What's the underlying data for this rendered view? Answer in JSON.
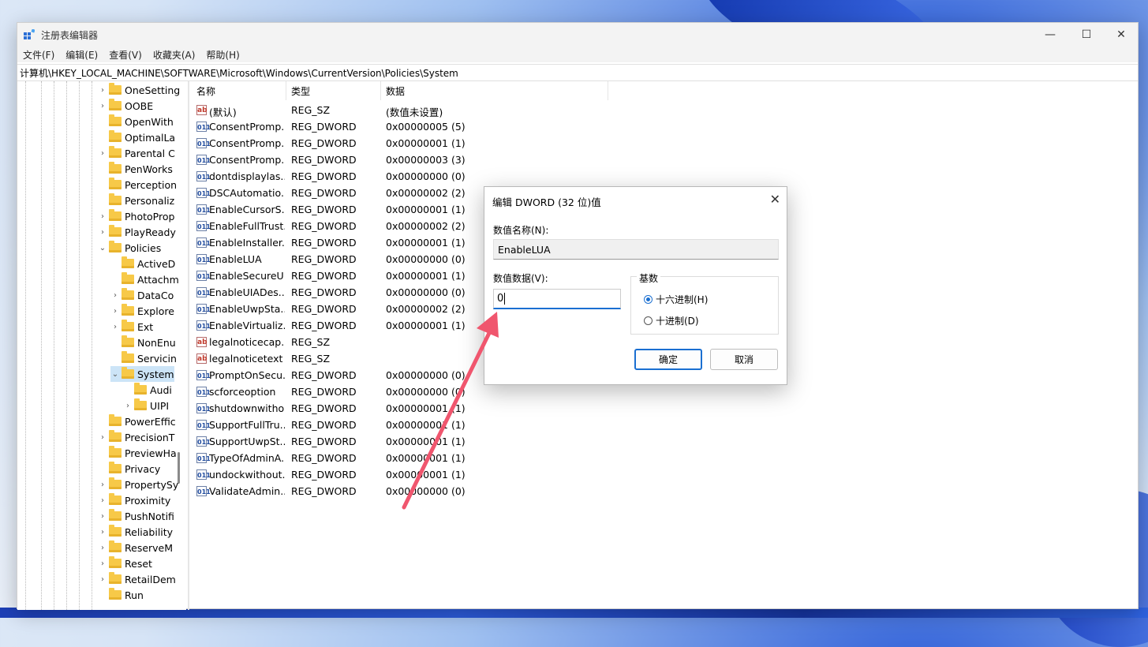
{
  "window": {
    "title": "注册表编辑器",
    "controls": {
      "minimize": "—",
      "maximize": "☐",
      "close": "✕"
    }
  },
  "menu": [
    "文件(F)",
    "编辑(E)",
    "查看(V)",
    "收藏夹(A)",
    "帮助(H)"
  ],
  "address": "计算机\\HKEY_LOCAL_MACHINE\\SOFTWARE\\Microsoft\\Windows\\CurrentVersion\\Policies\\System",
  "tree": [
    {
      "label": "OneSetting",
      "chev": "›"
    },
    {
      "label": "OOBE",
      "chev": "›"
    },
    {
      "label": "OpenWith",
      "chev": ""
    },
    {
      "label": "OptimalLa",
      "chev": ""
    },
    {
      "label": "Parental C",
      "chev": "›"
    },
    {
      "label": "PenWorks",
      "chev": ""
    },
    {
      "label": "Perception",
      "chev": ""
    },
    {
      "label": "Personaliz",
      "chev": ""
    },
    {
      "label": "PhotoProp",
      "chev": "›"
    },
    {
      "label": "PlayReady",
      "chev": "›"
    },
    {
      "label": "Policies",
      "chev": "⌄"
    },
    {
      "label": "ActiveD",
      "chev": ""
    },
    {
      "label": "Attachm",
      "chev": ""
    },
    {
      "label": "DataCo",
      "chev": "›"
    },
    {
      "label": "Explore",
      "chev": "›"
    },
    {
      "label": "Ext",
      "chev": "›"
    },
    {
      "label": "NonEnu",
      "chev": ""
    },
    {
      "label": "Servicin",
      "chev": ""
    },
    {
      "label": "System",
      "chev": "⌄"
    },
    {
      "label": "Audi",
      "chev": ""
    },
    {
      "label": "UIPI",
      "chev": "›"
    },
    {
      "label": "PowerEffic",
      "chev": ""
    },
    {
      "label": "PrecisionT",
      "chev": "›"
    },
    {
      "label": "PreviewHa",
      "chev": ""
    },
    {
      "label": "Privacy",
      "chev": ""
    },
    {
      "label": "PropertySy",
      "chev": "›"
    },
    {
      "label": "Proximity",
      "chev": "›"
    },
    {
      "label": "PushNotifi",
      "chev": "›"
    },
    {
      "label": "Reliability",
      "chev": "›"
    },
    {
      "label": "ReserveM",
      "chev": "›"
    },
    {
      "label": "Reset",
      "chev": "›"
    },
    {
      "label": "RetailDem",
      "chev": "›"
    },
    {
      "label": "Run",
      "chev": ""
    }
  ],
  "list": {
    "headers": [
      "名称",
      "类型",
      "数据"
    ],
    "rows": [
      {
        "name": "(默认)",
        "type": "REG_SZ",
        "data": "(数值未设置)",
        "icon": "ab"
      },
      {
        "name": "ConsentPromp...",
        "type": "REG_DWORD",
        "data": "0x00000005 (5)",
        "icon": "bin"
      },
      {
        "name": "ConsentPromp...",
        "type": "REG_DWORD",
        "data": "0x00000001 (1)",
        "icon": "bin"
      },
      {
        "name": "ConsentPromp...",
        "type": "REG_DWORD",
        "data": "0x00000003 (3)",
        "icon": "bin"
      },
      {
        "name": "dontdisplaylas...",
        "type": "REG_DWORD",
        "data": "0x00000000 (0)",
        "icon": "bin"
      },
      {
        "name": "DSCAutomatio...",
        "type": "REG_DWORD",
        "data": "0x00000002 (2)",
        "icon": "bin"
      },
      {
        "name": "EnableCursorS...",
        "type": "REG_DWORD",
        "data": "0x00000001 (1)",
        "icon": "bin"
      },
      {
        "name": "EnableFullTrust...",
        "type": "REG_DWORD",
        "data": "0x00000002 (2)",
        "icon": "bin"
      },
      {
        "name": "EnableInstaller...",
        "type": "REG_DWORD",
        "data": "0x00000001 (1)",
        "icon": "bin"
      },
      {
        "name": "EnableLUA",
        "type": "REG_DWORD",
        "data": "0x00000000 (0)",
        "icon": "bin"
      },
      {
        "name": "EnableSecureU...",
        "type": "REG_DWORD",
        "data": "0x00000001 (1)",
        "icon": "bin"
      },
      {
        "name": "EnableUIADes...",
        "type": "REG_DWORD",
        "data": "0x00000000 (0)",
        "icon": "bin"
      },
      {
        "name": "EnableUwpSta...",
        "type": "REG_DWORD",
        "data": "0x00000002 (2)",
        "icon": "bin"
      },
      {
        "name": "EnableVirtualiz...",
        "type": "REG_DWORD",
        "data": "0x00000001 (1)",
        "icon": "bin"
      },
      {
        "name": "legalnoticecap...",
        "type": "REG_SZ",
        "data": "",
        "icon": "ab"
      },
      {
        "name": "legalnoticetext",
        "type": "REG_SZ",
        "data": "",
        "icon": "ab"
      },
      {
        "name": "PromptOnSecu...",
        "type": "REG_DWORD",
        "data": "0x00000000 (0)",
        "icon": "bin"
      },
      {
        "name": "scforceoption",
        "type": "REG_DWORD",
        "data": "0x00000000 (0)",
        "icon": "bin"
      },
      {
        "name": "shutdownwitho...",
        "type": "REG_DWORD",
        "data": "0x00000001 (1)",
        "icon": "bin"
      },
      {
        "name": "SupportFullTru...",
        "type": "REG_DWORD",
        "data": "0x00000001 (1)",
        "icon": "bin"
      },
      {
        "name": "SupportUwpSt...",
        "type": "REG_DWORD",
        "data": "0x00000001 (1)",
        "icon": "bin"
      },
      {
        "name": "TypeOfAdminA...",
        "type": "REG_DWORD",
        "data": "0x00000001 (1)",
        "icon": "bin"
      },
      {
        "name": "undockwithout...",
        "type": "REG_DWORD",
        "data": "0x00000001 (1)",
        "icon": "bin"
      },
      {
        "name": "ValidateAdmin...",
        "type": "REG_DWORD",
        "data": "0x00000000 (0)",
        "icon": "bin"
      }
    ]
  },
  "dialog": {
    "title": "编辑 DWORD (32 位)值",
    "close": "✕",
    "name_label": "数值名称(N):",
    "name_value": "EnableLUA",
    "data_label": "数值数据(V):",
    "data_value": "0",
    "base_label": "基数",
    "radio_hex": "十六进制(H)",
    "radio_dec": "十进制(D)",
    "selected_base": "hex",
    "ok": "确定",
    "cancel": "取消"
  },
  "annotation": {
    "arrow_color": "#f0566e"
  }
}
